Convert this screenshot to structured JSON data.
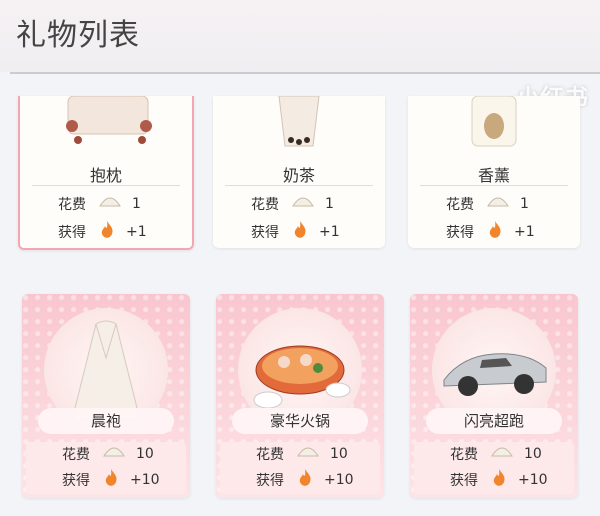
{
  "header": {
    "title": "礼物列表"
  },
  "watermark": "小红书",
  "labels": {
    "cost": "花费",
    "gain": "获得"
  },
  "top_cards": [
    {
      "name": "抱枕",
      "cost": "1",
      "gain": "+1",
      "icon": "pillow-icon"
    },
    {
      "name": "奶茶",
      "cost": "1",
      "gain": "+1",
      "icon": "milk-tea-icon"
    },
    {
      "name": "香薰",
      "cost": "1",
      "gain": "+1",
      "icon": "aroma-candle-icon"
    }
  ],
  "bottom_cards": [
    {
      "name": "晨袍",
      "cost": "10",
      "gain": "+10",
      "icon": "robe-icon"
    },
    {
      "name": "豪华火锅",
      "cost": "10",
      "gain": "+10",
      "icon": "hotpot-icon"
    },
    {
      "name": "闪亮超跑",
      "cost": "10",
      "gain": "+10",
      "icon": "sports-car-icon"
    }
  ],
  "colors": {
    "card_pink": "#f9c6cf",
    "selected_border": "#f3a7b0",
    "flame": "#f0852e"
  }
}
